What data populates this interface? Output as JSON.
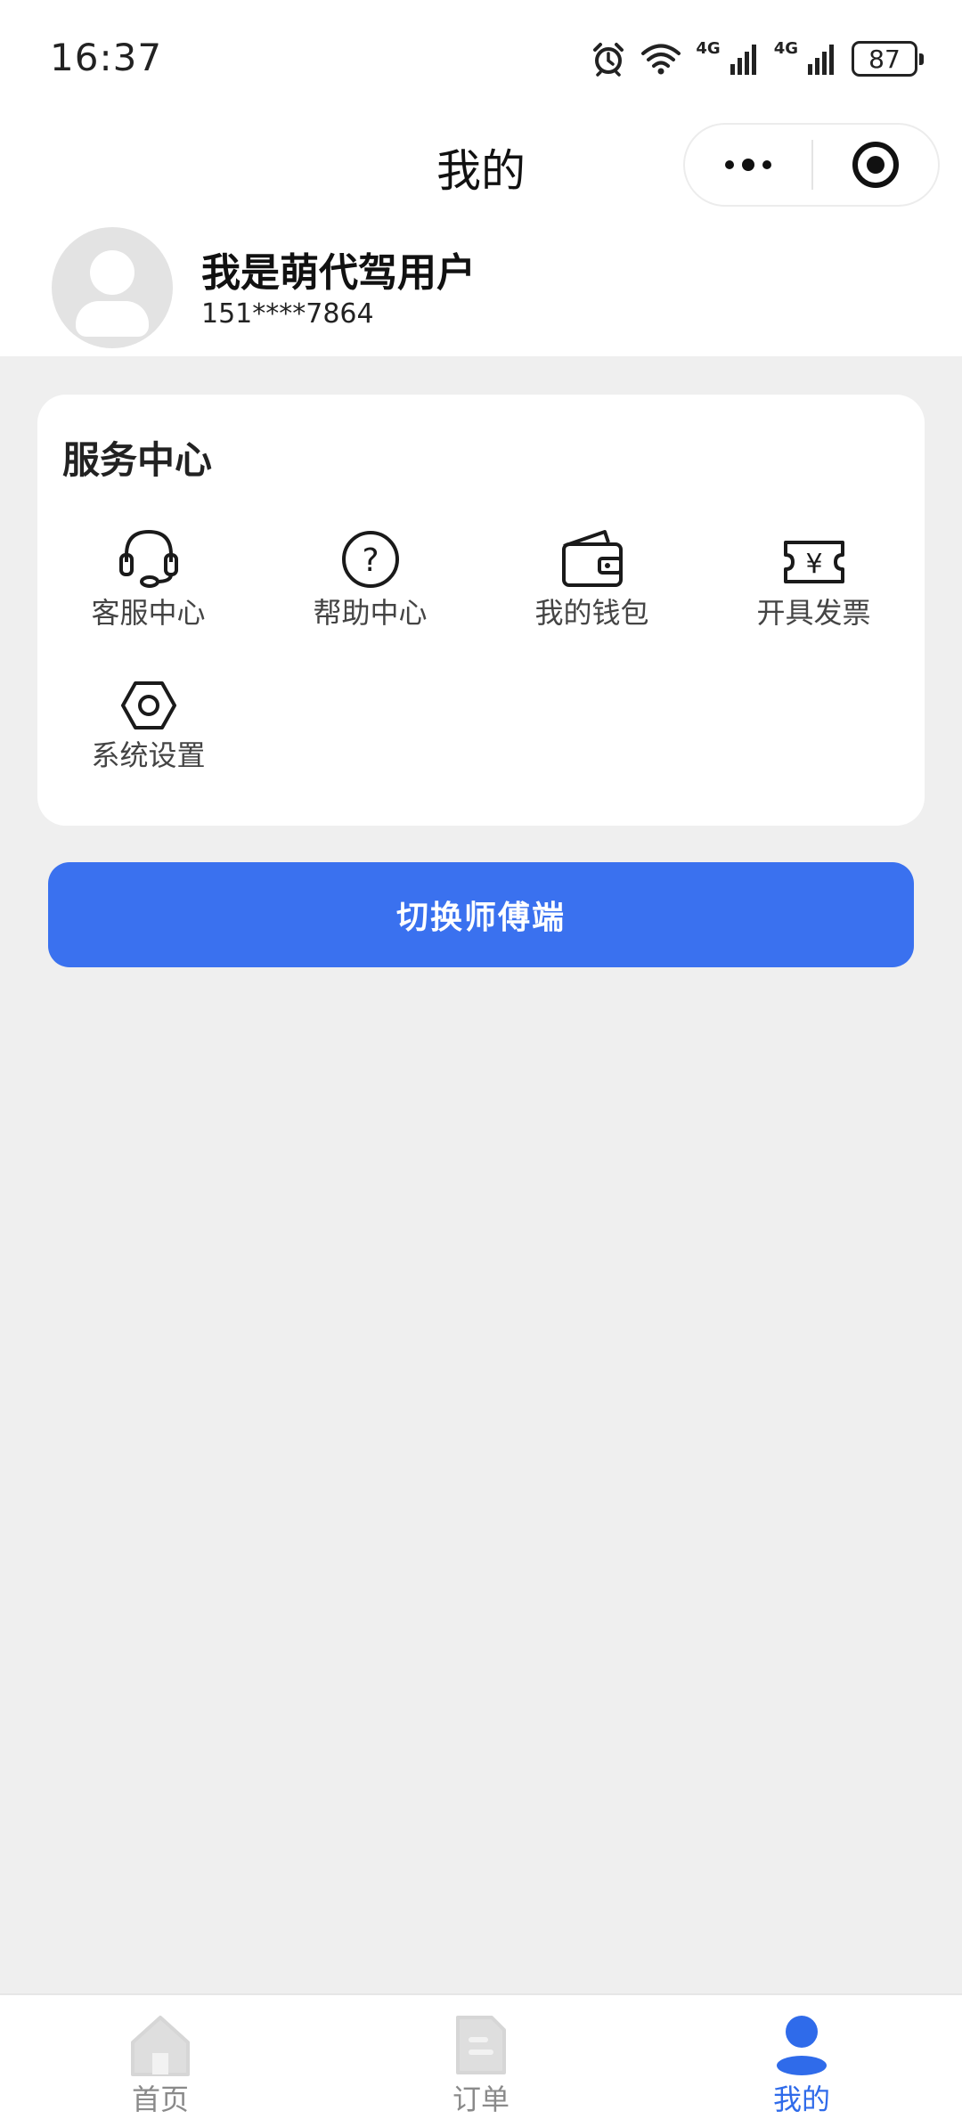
{
  "status_bar": {
    "time": "16:37",
    "network_1": "4G",
    "network_2": "4G",
    "battery": "87",
    "icons": [
      "alarm-icon",
      "wifi-icon",
      "signal-icon",
      "signal-icon",
      "battery-icon"
    ]
  },
  "nav": {
    "title": "我的",
    "capsule_icons": [
      "more-dots-icon",
      "close-target-icon"
    ]
  },
  "profile": {
    "name": "我是萌代驾用户",
    "phone": "151****7864"
  },
  "service_center": {
    "title": "服务中心",
    "items": [
      {
        "label": "客服中心",
        "icon": "headset-icon"
      },
      {
        "label": "帮助中心",
        "icon": "help-icon"
      },
      {
        "label": "我的钱包",
        "icon": "wallet-icon"
      },
      {
        "label": "开具发票",
        "icon": "invoice-icon"
      },
      {
        "label": "系统设置",
        "icon": "settings-icon"
      }
    ]
  },
  "switch_button": {
    "label": "切换师傅端"
  },
  "tab_bar": {
    "items": [
      {
        "label": "首页",
        "icon": "home-icon",
        "active": false
      },
      {
        "label": "订单",
        "icon": "order-icon",
        "active": false
      },
      {
        "label": "我的",
        "icon": "profile-icon",
        "active": true
      }
    ]
  },
  "colors": {
    "accent": "#3a71ef",
    "tab_active": "#2f6bea",
    "tab_inactive": "#8a8a8a",
    "page_background": "#efefef"
  }
}
